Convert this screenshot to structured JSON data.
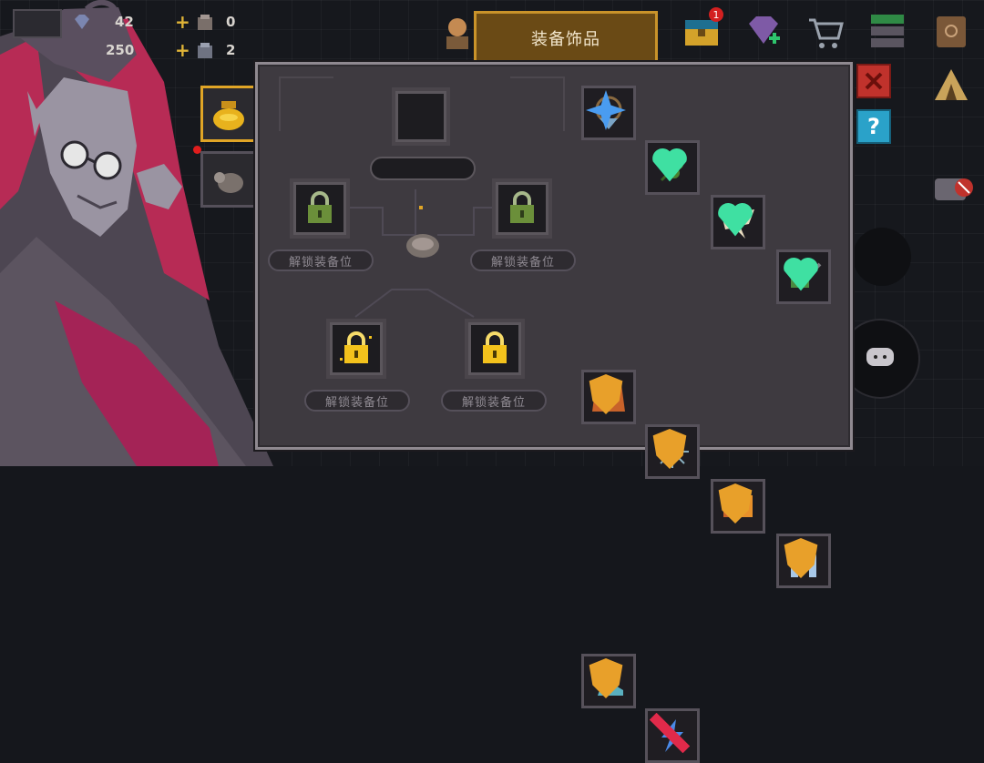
{
  "hud": {
    "gems": "42",
    "coins": "250",
    "material_a_count": "0",
    "material_b_count": "2",
    "plus_symbol": "+"
  },
  "title": "装备饰品",
  "notification_count": "1",
  "slots": {
    "unlock_label": "解锁装备位"
  },
  "help_symbol": "?",
  "items": [
    {
      "icon": "amulet-icon",
      "badge": "blue-star"
    },
    {
      "icon": "clover-leaf-icon",
      "badge": "green-heart"
    },
    {
      "icon": "bone-horn-icon",
      "badge": "green-heart"
    },
    {
      "icon": "green-gun-icon",
      "badge": "green-heart"
    },
    {
      "icon": "orange-vest-icon",
      "badge": "orange-shield"
    },
    {
      "icon": "spiked-orb-icon",
      "badge": "orange-shield"
    },
    {
      "icon": "fire-gem-icon",
      "badge": "orange-shield"
    },
    {
      "icon": "blue-hood-icon",
      "badge": "orange-shield"
    },
    {
      "icon": "ice-boot-icon",
      "badge": "orange-shield"
    },
    {
      "icon": "lightning-icon",
      "badge": "red-sword"
    }
  ],
  "colors": {
    "panel": "#3e3a40",
    "title_tab": "#6a4a15",
    "gold_lock": "#f3c21c",
    "green_lock": "#6b8f3a",
    "close_button": "#c0322c",
    "help_button": "#2aa2c9"
  }
}
